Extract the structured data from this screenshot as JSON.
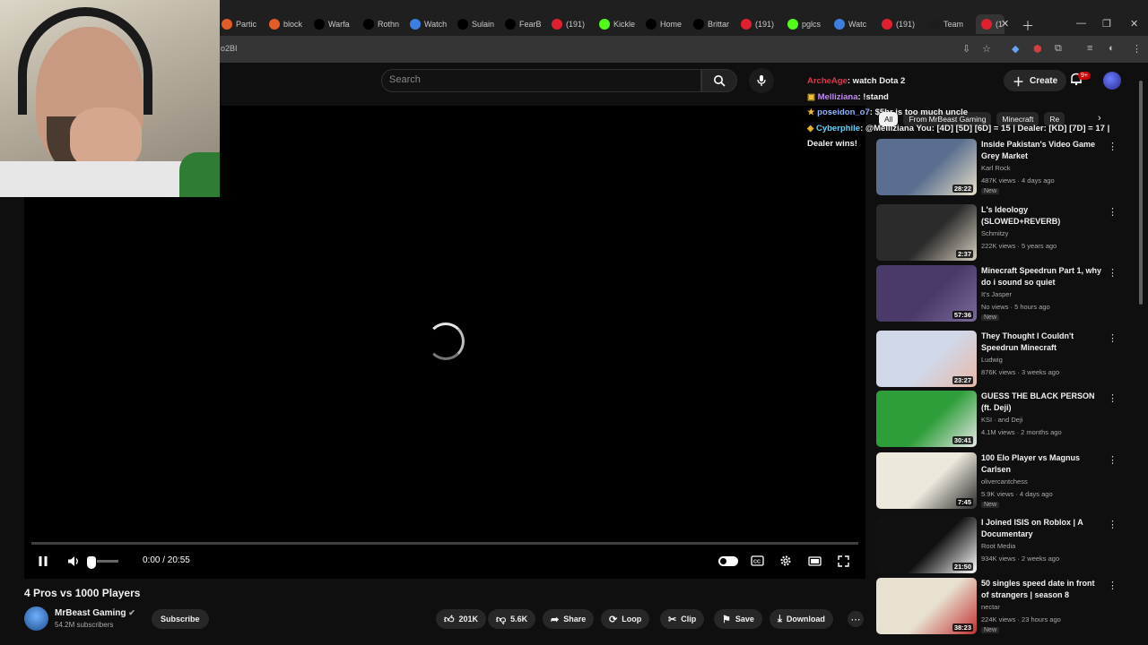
{
  "browser": {
    "tabs": [
      {
        "label": "Partic",
        "color": "#e25c2a"
      },
      {
        "label": "block",
        "color": "#e25c2a"
      },
      {
        "label": "Warfa",
        "color": "#000000"
      },
      {
        "label": "Rothn",
        "color": "#000000"
      },
      {
        "label": "Watch",
        "color": "#3d7fe0"
      },
      {
        "label": "Sulain",
        "color": "#000000"
      },
      {
        "label": "FearB",
        "color": "#000000"
      },
      {
        "label": "(191)",
        "color": "#e02030"
      },
      {
        "label": "Kickle",
        "color": "#53fc18"
      },
      {
        "label": "Home",
        "color": "#000000"
      },
      {
        "label": "Brittar",
        "color": "#000000"
      },
      {
        "label": "(191)",
        "color": "#e02030"
      },
      {
        "label": "pglcs",
        "color": "#53fc18"
      },
      {
        "label": "Watc",
        "color": "#3d7fe0"
      },
      {
        "label": "(191)",
        "color": "#e02030"
      },
      {
        "label": "Team",
        "color": "#1c1c1c"
      },
      {
        "label": "(1",
        "color": "#e02030"
      }
    ],
    "address_fragment": "o2BI"
  },
  "youtube": {
    "search_placeholder": "Search",
    "create_label": "Create",
    "notif_count": "9+"
  },
  "chat": [
    {
      "user": "ArcheAge",
      "user_color": "#d9384a",
      "text": ": watch Dota 2",
      "badge": ""
    },
    {
      "user": "Melliziana",
      "user_color": "#c08cf0",
      "text": ": !stand",
      "badge": "▣"
    },
    {
      "user": "poseidon_o7",
      "user_color": "#8fb4ff",
      "text": ": $5hr is too much uncle",
      "badge": "★"
    },
    {
      "user": "Cyberphile",
      "user_color": "#59d7ff",
      "text": ": @Melliziana You: [4D] [5D] [6D] = 15 | Dealer: [KD] [7D] = 17 | Dealer wins!",
      "badge": "◈"
    }
  ],
  "chips": [
    "All",
    "From MrBeast Gaming",
    "Minecraft",
    "Re"
  ],
  "player": {
    "time": "0:00 / 20:55",
    "volume_fraction": 0.12
  },
  "video": {
    "title": "4 Pros vs 1000 Players",
    "channel": "MrBeast Gaming",
    "subs": "54.2M subscribers",
    "subscribe": "Subscribe",
    "likes": "201K",
    "dislikes": "5.6K",
    "share": "Share",
    "loop": "Loop",
    "clip": "Clip",
    "save": "Save",
    "download": "Download"
  },
  "recommendations": [
    {
      "title": "Inside Pakistan's Video Game Grey Market",
      "channel": "Karl Rock",
      "meta": "487K views · 4 days ago",
      "badge": "New",
      "duration": "28:22",
      "thumb": "#5a6f8f",
      "thumb2": "#e8e0c8"
    },
    {
      "title": "L's Ideology (SLOWED+REVERB)",
      "channel": "Schmitzy",
      "meta": "222K views · 5 years ago",
      "badge": "",
      "duration": "2:37",
      "thumb": "#2b2b2b",
      "thumb2": "#d8d0c0"
    },
    {
      "title": "Minecraft Speedrun Part 1, why do i sound so quiet",
      "channel": "It's Jasper",
      "meta": "No views · 5 hours ago",
      "badge": "New",
      "duration": "57:36",
      "thumb": "#4a3a6a",
      "thumb2": "#7a6a9a"
    },
    {
      "title": "They Thought I Couldn't Speedrun Minecraft",
      "channel": "Ludwig",
      "meta": "876K views · 3 weeks ago",
      "badge": "",
      "duration": "23:27",
      "thumb": "#d0d8e8",
      "thumb2": "#e8b8a8"
    },
    {
      "title": "GUESS THE BLACK PERSON (ft. Deji)",
      "channel": "KSI · and Deji",
      "meta": "4.1M views · 2 months ago",
      "badge": "",
      "duration": "30:41",
      "thumb": "#2e9e3a",
      "thumb2": "#e8e8e8"
    },
    {
      "title": "100 Elo Player vs Magnus Carlsen",
      "channel": "olivercantchess",
      "meta": "5.9K views · 4 days ago",
      "badge": "New",
      "duration": "7:45",
      "thumb": "#ece8dc",
      "thumb2": "#2c2c2c"
    },
    {
      "title": "I Joined ISIS on Roblox | A Documentary",
      "channel": "Root Media",
      "meta": "934K views · 2 weeks ago",
      "badge": "",
      "duration": "21:50",
      "thumb": "#111111",
      "thumb2": "#ffffff"
    },
    {
      "title": "50 singles speed date in front of strangers | season 8",
      "channel": "nectar",
      "meta": "224K views · 23 hours ago",
      "badge": "New",
      "duration": "38:23",
      "thumb": "#e8e0d0",
      "thumb2": "#c03030"
    }
  ],
  "colors": {
    "accent": "#cc0000",
    "bg": "#0f0f0f",
    "pill": "#272727"
  }
}
